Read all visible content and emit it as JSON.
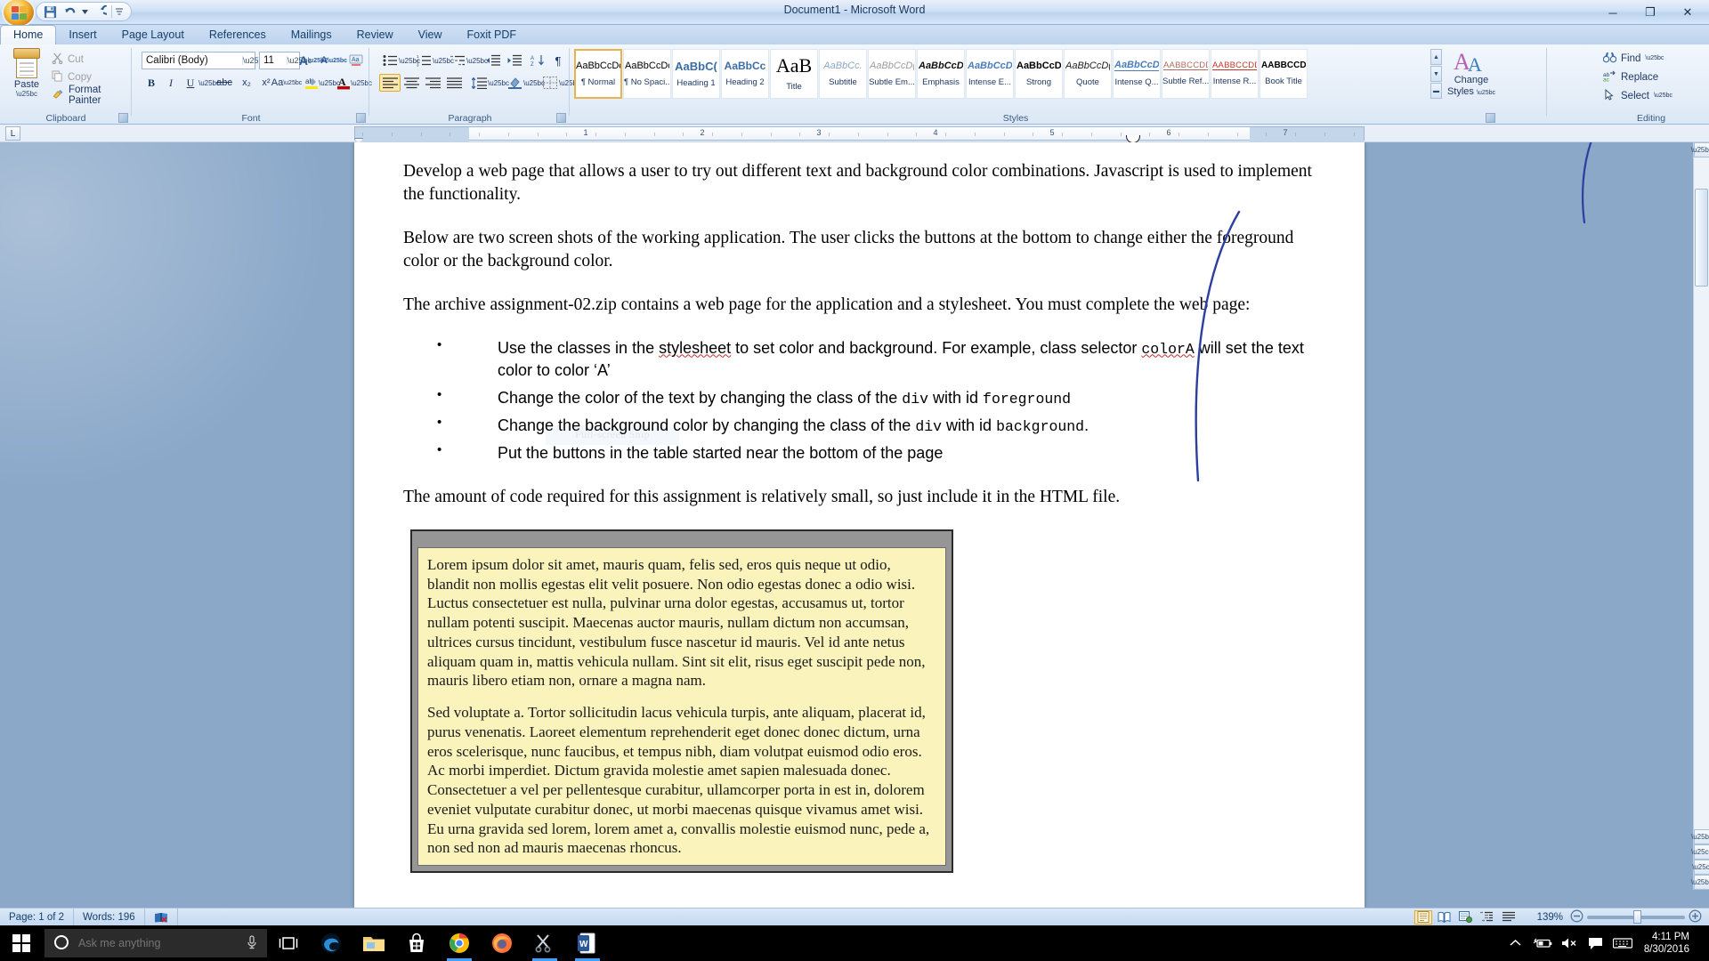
{
  "window": {
    "title": "Document1 - Microsoft Word",
    "minimize_label": "─",
    "restore_label": "❐",
    "close_label": "✕"
  },
  "quick_access": {
    "save_label": "Save",
    "undo_label": "Undo",
    "redo_label": "Redo",
    "customize_label": "Customize Quick Access Toolbar"
  },
  "tabs": [
    {
      "label": "Home",
      "active": true
    },
    {
      "label": "Insert",
      "active": false
    },
    {
      "label": "Page Layout",
      "active": false
    },
    {
      "label": "References",
      "active": false
    },
    {
      "label": "Mailings",
      "active": false
    },
    {
      "label": "Review",
      "active": false
    },
    {
      "label": "View",
      "active": false
    },
    {
      "label": "Foxit PDF",
      "active": false
    }
  ],
  "ribbon": {
    "clipboard": {
      "group_label": "Clipboard",
      "paste_label": "Paste",
      "cut_label": "Cut",
      "copy_label": "Copy",
      "format_painter_label": "Format Painter"
    },
    "font": {
      "group_label": "Font",
      "font_name": "Calibri (Body)",
      "font_size": "11",
      "grow_label": "A",
      "shrink_label": "A",
      "clear_formatting_label": "Aa",
      "bold_label": "B",
      "italic_label": "I",
      "underline_label": "U",
      "strikethrough_label": "abc",
      "subscript_label": "x₂",
      "superscript_label": "x²",
      "change_case_label": "Aa",
      "highlight_label": "ab",
      "font_color_label": "A"
    },
    "paragraph": {
      "group_label": "Paragraph",
      "bullets_label": "☰",
      "numbering_label": "☷",
      "multilevel_label": "≡",
      "decrease_indent_label": "⇤",
      "increase_indent_label": "⇥",
      "sort_label": "A↓",
      "show_marks_label": "¶",
      "align_left_label": "≡",
      "align_center_label": "≡",
      "align_right_label": "≡",
      "justify_label": "≡",
      "line_spacing_label": "↕",
      "shading_label": "▣",
      "borders_label": "▦"
    },
    "styles": {
      "group_label": "Styles",
      "change_styles_label": "Change\nStyles",
      "change_styles_line1": "Change",
      "change_styles_line2": "Styles",
      "scroll_up_label": "▲",
      "scroll_down_label": "▼",
      "more_label": "▬",
      "items": [
        {
          "preview": "AaBbCcDc",
          "name": "¶ Normal",
          "selected": true,
          "style": "normal"
        },
        {
          "preview": "AaBbCcDc",
          "name": "¶ No Spaci...",
          "selected": false,
          "style": "normal"
        },
        {
          "preview": "AaBbC(",
          "name": "Heading 1",
          "selected": false,
          "style": "h1"
        },
        {
          "preview": "AaBbCc",
          "name": "Heading 2",
          "selected": false,
          "style": "h2"
        },
        {
          "preview": "AaB",
          "name": "Title",
          "selected": false,
          "style": "title"
        },
        {
          "preview": "AaBbCc.",
          "name": "Subtitle",
          "selected": false,
          "style": "subtitle"
        },
        {
          "preview": "AaBbCcD(",
          "name": "Subtle Em...",
          "selected": false,
          "style": "subtleem"
        },
        {
          "preview": "AaBbCcD(",
          "name": "Emphasis",
          "selected": false,
          "style": "emphasis"
        },
        {
          "preview": "AaBbCcD(",
          "name": "Intense E...",
          "selected": false,
          "style": "intenseem"
        },
        {
          "preview": "AaBbCcD(",
          "name": "Strong",
          "selected": false,
          "style": "strong"
        },
        {
          "preview": "AaBbCcD(",
          "name": "Quote",
          "selected": false,
          "style": "quote"
        },
        {
          "preview": "AaBbCcD(",
          "name": "Intense Q...",
          "selected": false,
          "style": "intenseq"
        },
        {
          "preview": "AABBCCDD",
          "name": "Subtle Ref...",
          "selected": false,
          "style": "subtleref"
        },
        {
          "preview": "AABBCCDD",
          "name": "Intense R...",
          "selected": false,
          "style": "intenseref"
        },
        {
          "preview": "AABBCCDD",
          "name": "Book Title",
          "selected": false,
          "style": "booktitle"
        }
      ]
    },
    "editing": {
      "group_label": "Editing",
      "find_label": "Find",
      "replace_label": "Replace",
      "select_label": "Select"
    }
  },
  "ruler": {
    "tab_selector_label": "L",
    "marks": [
      "1",
      "2",
      "3",
      "4",
      "5",
      "6",
      "7"
    ]
  },
  "document": {
    "paragraphs": [
      "Develop a web page that allows a user to try out different text and background color combinations. Javascript is used to implement the functionality.",
      "Below are two screen shots of the working application. The user clicks the buttons at the bottom to change either the foreground color or the background color.",
      "The archive assignment-02.zip contains a web page for the application and a stylesheet. You must complete the web page:"
    ],
    "watermark_text": "Full-screen Snip",
    "bullets": [
      {
        "segments": [
          {
            "text": "Use the classes in the ",
            "mono": false
          },
          {
            "text": "stylesheet",
            "mono": false,
            "squiggle": true
          },
          {
            "text": " to set color and background. For example, class selector ",
            "mono": false
          },
          {
            "text": "colorA",
            "mono": true,
            "squiggle": true
          },
          {
            "text": " will set the text color to color ‘A’",
            "mono": false
          }
        ]
      },
      {
        "segments": [
          {
            "text": "Change the color of the text by changing the class of the ",
            "mono": false
          },
          {
            "text": "div",
            "mono": true
          },
          {
            "text": " with id ",
            "mono": false
          },
          {
            "text": "foreground",
            "mono": true
          }
        ]
      },
      {
        "segments": [
          {
            "text": "Change the background color by changing the class of the ",
            "mono": false
          },
          {
            "text": "div",
            "mono": true
          },
          {
            "text": " with id ",
            "mono": false
          },
          {
            "text": "background",
            "mono": true
          },
          {
            "text": ".",
            "mono": false
          }
        ]
      },
      {
        "segments": [
          {
            "text": "Put the buttons in the table started near the bottom of the page",
            "mono": false
          }
        ]
      }
    ],
    "closing_paragraph": "The amount of code required for this assignment is relatively small, so just include it in the HTML file.",
    "screenshot_box": {
      "paragraph1": "Lorem ipsum dolor sit amet, mauris quam, felis sed, eros quis neque ut odio, blandit non mollis egestas elit velit posuere. Non odio egestas donec a odio wisi. Luctus consectetuer est nulla, pulvinar urna dolor egestas, accusamus ut, tortor nullam potenti suscipit. Maecenas auctor mauris, nullam dictum non accumsan, ultrices cursus tincidunt, vestibulum fusce nascetur id mauris. Vel id ante netus aliquam quam in, mattis vehicula nullam. Sint sit elit, risus eget suscipit pede non, mauris libero etiam non, ornare a magna nam.",
      "paragraph2": "Sed voluptate a. Tortor sollicitudin lacus vehicula turpis, ante aliquam, placerat id, purus venenatis. Laoreet elementum reprehenderit eget donec donec dictum, urna eros scelerisque, nunc faucibus, et tempus nibh, diam volutpat euismod odio eros. Ac morbi imperdiet. Dictum gravida molestie amet sapien malesuada donec. Consectetuer a vel per pellentesque curabitur, ullamcorper porta in est in, dolorem eveniet vulputate curabitur donec, ut morbi maecenas quisque vivamus amet wisi. Eu urna gravida sed lorem, lorem amet a, convallis molestie euismod nunc, pede a, non sed non ad mauris maecenas rhoncus."
    }
  },
  "status_bar": {
    "page_label": "Page: 1 of 2",
    "words_label": "Words: 196",
    "proofing_label": "Proofing errors",
    "zoom_level": "139%",
    "zoom_out_label": "−",
    "zoom_in_label": "+",
    "view_print_label": "Print Layout",
    "view_fullscreen_label": "Full Screen Reading",
    "view_web_label": "Web Layout",
    "view_outline_label": "Outline",
    "view_draft_label": "Draft"
  },
  "taskbar": {
    "start_label": "Start",
    "search_placeholder": "Ask me anything",
    "search_value": "",
    "cortana_label": "Cortana",
    "mic_label": "microphone",
    "task_view_label": "Task View",
    "apps": [
      {
        "name": "edge-icon",
        "running": false
      },
      {
        "name": "file-explorer-icon",
        "running": false
      },
      {
        "name": "store-icon",
        "running": false
      },
      {
        "name": "chrome-icon",
        "running": true
      },
      {
        "name": "firefox-icon",
        "running": false
      },
      {
        "name": "snipping-tool-icon",
        "running": true
      },
      {
        "name": "word-icon",
        "running": true
      }
    ],
    "tray": {
      "show_hidden_label": "⌃",
      "battery_label": "battery",
      "volume_label": "volume",
      "action_center_label": "Action Center",
      "keyboard_label": "keyboard",
      "time": "4:11 PM",
      "date": "8/30/2016"
    }
  },
  "colors": {
    "ribbon_blue": "#dce8f6",
    "title_blue": "#1b3a63",
    "accent_orange": "#e8b54d",
    "desktop_blue": "#8ba8c9",
    "highlight_yellow": "#faf3bb",
    "pen_blue": "#2b3f9e"
  }
}
